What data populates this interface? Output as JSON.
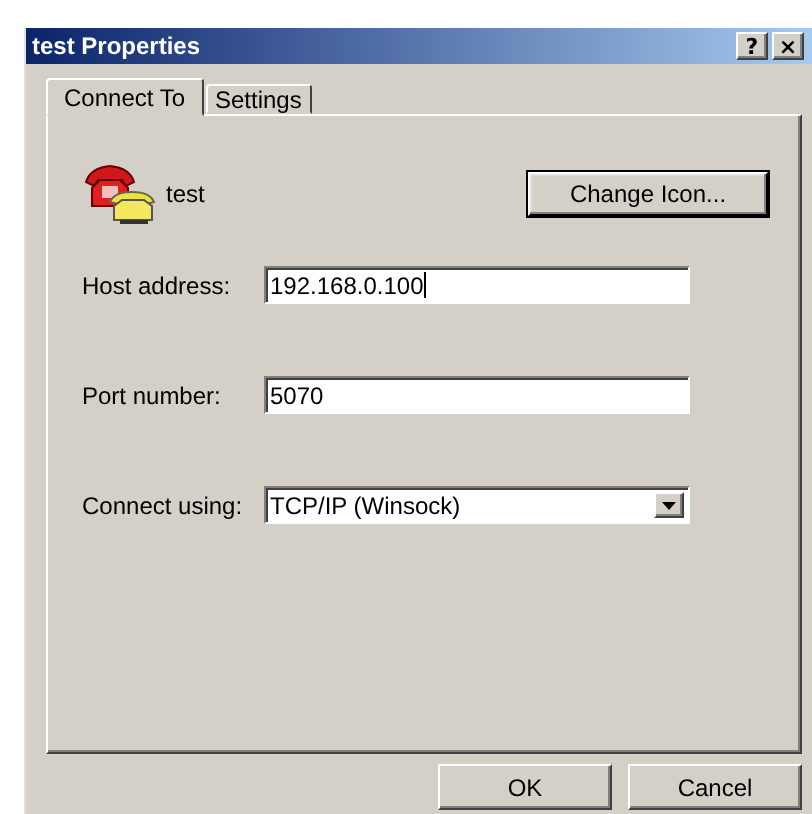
{
  "window": {
    "title": "test Properties",
    "title_buttons": [
      "?",
      "×"
    ]
  },
  "tabs": [
    {
      "label": "Connect To",
      "selected": true
    },
    {
      "label": "Settings",
      "selected": false
    }
  ],
  "connection": {
    "name": "test",
    "change_icon_button": "Change Icon..."
  },
  "fields": [
    {
      "kind": "text",
      "label": "Host address:",
      "value": "192.168.0.100",
      "focused": true
    },
    {
      "kind": "text",
      "label": "Port number:",
      "value": "5070",
      "focused": false
    },
    {
      "kind": "dropdown",
      "label": "Connect using:",
      "value": "TCP/IP (Winsock)",
      "focused": false
    }
  ],
  "buttons": [
    "OK",
    "Cancel"
  ]
}
